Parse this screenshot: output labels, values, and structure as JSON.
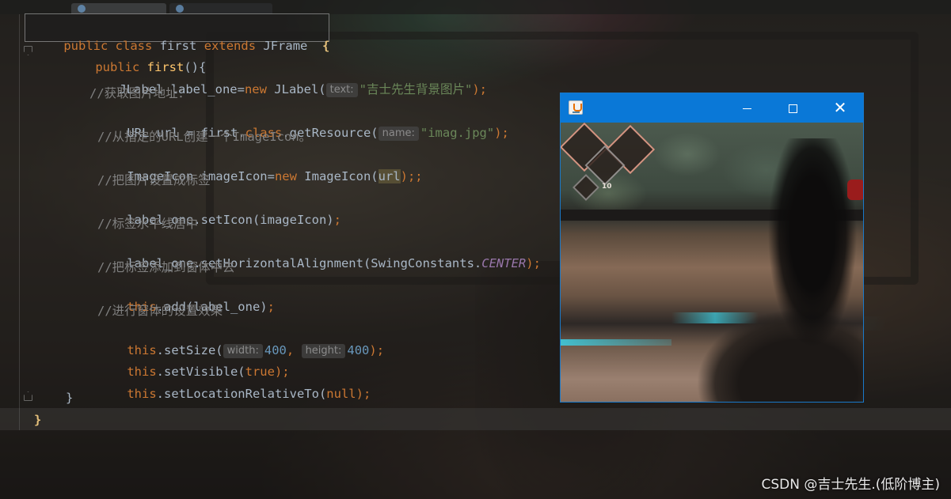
{
  "editor": {
    "class_header": {
      "kw_public": "public",
      "kw_class": "class",
      "class_name": "first",
      "kw_extends": "extends",
      "super_name": "JFrame",
      "brace_open": "{"
    },
    "lines": {
      "constructor": {
        "kw": "public",
        "name": "first",
        "rest": "(){"
      },
      "label_decl": {
        "pre": "JLabel label_one=",
        "kw_new": "new",
        "type": " JLabel(",
        "hint": "text:",
        "str": "\"吉士先生背景图片\"",
        "end": ");"
      },
      "comment_1": "//获取图片地址：",
      "url_decl": {
        "pre": "URL url = first.",
        "kw_class": "class",
        "mid": ".getResource(",
        "hint": "name:",
        "str": "\"imag.jpg\"",
        "end": ");"
      },
      "comment_2": "//从指定的URL创建一个ImageIcon。",
      "icon_decl": {
        "pre": "ImageIcon imageIcon=",
        "kw_new": "new",
        "mid": " ImageIcon(",
        "arg": "url",
        "end": ");;"
      },
      "comment_3": "//把图片设置成标签",
      "set_icon": {
        "text": "label_one.setIcon(imageIcon)",
        "semi": ";"
      },
      "comment_4": "//标签水平线居中",
      "set_align": {
        "pre": "label_one.setHorizontalAlignment(SwingConstants.",
        "const": "CENTER",
        "end": ");"
      },
      "comment_5": "//把标签添加到窗体中去",
      "add": {
        "kw_this": "this",
        "rest": ".add(label_one)",
        "semi": ";"
      },
      "comment_6": "//进行窗体的设置效果",
      "set_size": {
        "kw_this": "this",
        "mid": ".setSize(",
        "hint_w": "width:",
        "w": "400",
        "comma": ",",
        "hint_h": "height:",
        "h": "400",
        "end": ");"
      },
      "set_visible": {
        "kw_this": "this",
        "mid": ".setVisible(",
        "val": "true",
        "end": ");"
      },
      "set_location": {
        "kw_this": "this",
        "mid": ".setLocationRelativeTo(",
        "val": "null",
        "end": ");"
      },
      "close_ctor": "}",
      "close_class": "}"
    }
  },
  "java_window": {
    "title": "",
    "hud_count": "10",
    "buttons": {
      "minimize": "minimize",
      "maximize": "maximize",
      "close": "✕"
    }
  },
  "watermark": "CSDN @吉士先生.(低阶博主)",
  "colors": {
    "keyword": "#cc7832",
    "method": "#ffc66d",
    "string": "#6a8759",
    "number": "#6897bb",
    "comment": "#808080",
    "constant": "#9876aa",
    "titlebar": "#0a78d7"
  }
}
